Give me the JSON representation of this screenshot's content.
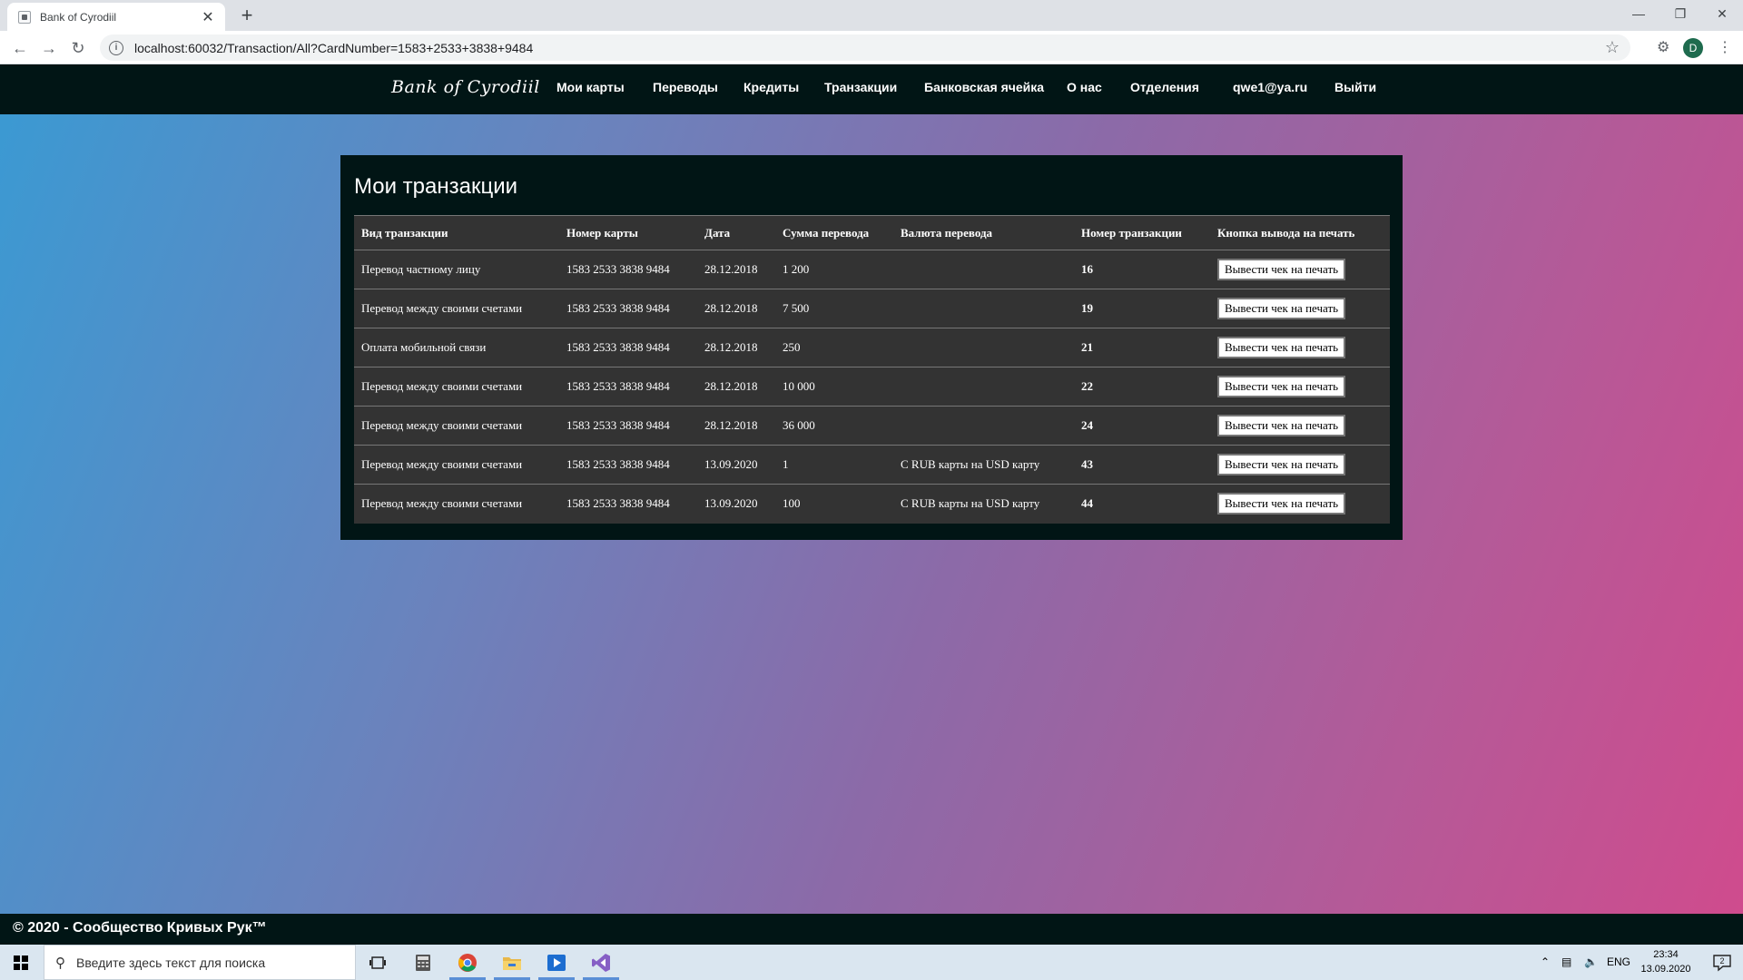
{
  "browser": {
    "tab_title": "Bank of Cyrodiil",
    "tab_close": "✕",
    "new_tab": "+",
    "url": "localhost:60032/Transaction/All?CardNumber=1583+2533+3838+9484",
    "profile_initial": "D"
  },
  "site": {
    "brand": "Bank of Cyrodiil",
    "nav": {
      "my_cards": "Мои карты",
      "transfers": "Переводы",
      "credits": "Кредиты",
      "transactions": "Транзакции",
      "safe_box": "Банковская ячейка",
      "about": "О нас",
      "branches": "Отделения",
      "user_email": "qwe1@ya.ru",
      "logout": "Выйти"
    }
  },
  "main": {
    "title": "Мои транзакции",
    "headers": [
      "Вид транзакции",
      "Номер карты",
      "Дата",
      "Сумма перевода",
      "Валюта перевода",
      "Номер транзакции",
      "Кнопка вывода на печать"
    ],
    "print_label": "Вывести чек на печать",
    "rows": [
      {
        "type": "Перевод частному лицу",
        "card": "1583 2533 3838 9484",
        "date": "28.12.2018",
        "amount": "1 200",
        "currency": "",
        "id": "16"
      },
      {
        "type": "Перевод между своими счетами",
        "card": "1583 2533 3838 9484",
        "date": "28.12.2018",
        "amount": "7 500",
        "currency": "",
        "id": "19"
      },
      {
        "type": "Оплата мобильной связи",
        "card": "1583 2533 3838 9484",
        "date": "28.12.2018",
        "amount": "250",
        "currency": "",
        "id": "21"
      },
      {
        "type": "Перевод между своими счетами",
        "card": "1583 2533 3838 9484",
        "date": "28.12.2018",
        "amount": "10 000",
        "currency": "",
        "id": "22"
      },
      {
        "type": "Перевод между своими счетами",
        "card": "1583 2533 3838 9484",
        "date": "28.12.2018",
        "amount": "36 000",
        "currency": "",
        "id": "24"
      },
      {
        "type": "Перевод между своими счетами",
        "card": "1583 2533 3838 9484",
        "date": "13.09.2020",
        "amount": "1",
        "currency": "С RUB карты на USD карту",
        "id": "43"
      },
      {
        "type": "Перевод между своими счетами",
        "card": "1583 2533 3838 9484",
        "date": "13.09.2020",
        "amount": "100",
        "currency": "С RUB карты на USD карту",
        "id": "44"
      }
    ]
  },
  "footer": {
    "text": "© 2020 - Сообщество Кривых Рук™"
  },
  "taskbar": {
    "search_placeholder": "Введите здесь текст для поиска",
    "language": "ENG",
    "time": "23:34",
    "date": "13.09.2020",
    "notification_count": "2"
  }
}
